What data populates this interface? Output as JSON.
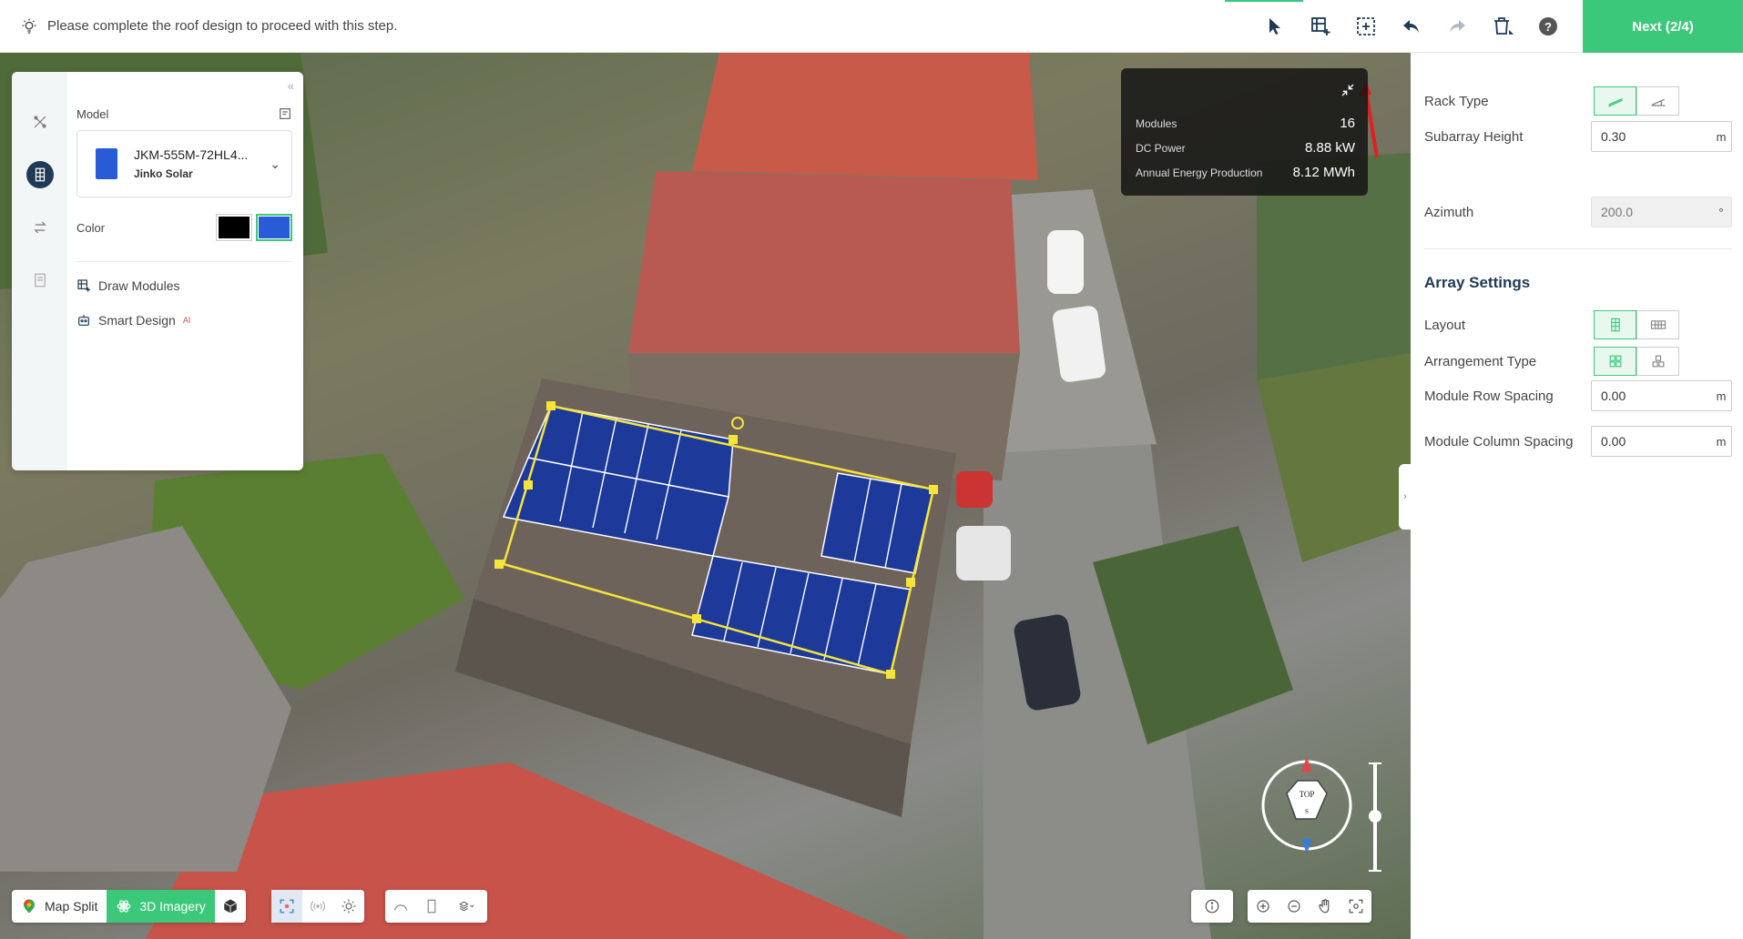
{
  "topbar": {
    "tip": "Please complete the roof design to proceed with this step.",
    "next_label": "Next (2/4)",
    "help_label": "?"
  },
  "left_panel": {
    "model_label": "Model",
    "model_name": "JKM-555M-72HL4...",
    "model_brand": "Jinko Solar",
    "color_label": "Color",
    "colors": [
      "#000000",
      "#2a5bd7"
    ],
    "selected_color": "#2a5bd7",
    "draw_modules": "Draw Modules",
    "smart_design": "Smart Design",
    "smart_design_badge": "AI"
  },
  "stats": {
    "modules_label": "Modules",
    "modules_value": "16",
    "dc_power_label": "DC Power",
    "dc_power_value": "8.88 kW",
    "annual_label": "Annual Energy Production",
    "annual_value": "8.12 MWh"
  },
  "compass": {
    "top_label": "TOP",
    "dir_label": "S"
  },
  "bottom": {
    "map_split": "Map Split",
    "imagery_3d": "3D Imagery"
  },
  "right_panel": {
    "rack_type_label": "Rack Type",
    "subarray_height_label": "Subarray Height",
    "subarray_height_value": "0.30",
    "subarray_height_unit": "m",
    "azimuth_label": "Azimuth",
    "azimuth_placeholder": "200.0",
    "azimuth_unit": "°",
    "array_settings_title": "Array Settings",
    "layout_label": "Layout",
    "arrangement_label": "Arrangement Type",
    "row_spacing_label": "Module Row Spacing",
    "row_spacing_value": "0.00",
    "row_spacing_unit": "m",
    "col_spacing_label": "Module Column Spacing",
    "col_spacing_value": "0.00",
    "col_spacing_unit": "m"
  },
  "colors": {
    "accent": "#3cc87a",
    "panel_blue": "#2a5bd7",
    "navy": "#1f3a56"
  }
}
